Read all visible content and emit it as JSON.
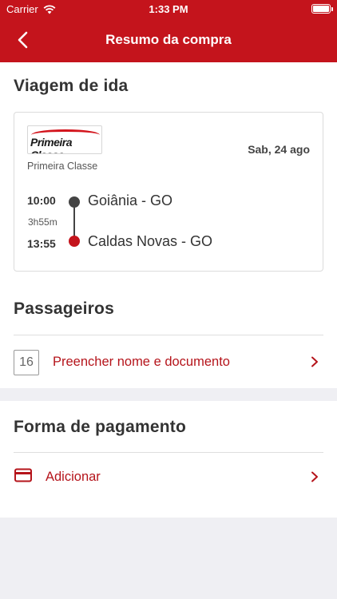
{
  "status_bar": {
    "carrier": "Carrier",
    "time": "1:33 PM"
  },
  "nav": {
    "title": "Resumo da compra"
  },
  "trip_section": {
    "heading": "Viagem de ida",
    "logo_text": "Primeira Classe",
    "company": "Primeira Classe",
    "date": "Sab, 24 ago",
    "departure_time": "10:00",
    "duration": "3h55m",
    "arrival_time": "13:55",
    "origin": "Goiânia - GO",
    "destination": "Caldas Novas - GO"
  },
  "passengers_section": {
    "heading": "Passageiros",
    "seat_number": "16",
    "fill_label": "Preencher nome e documento"
  },
  "payment_section": {
    "heading": "Forma de pagamento",
    "add_label": "Adicionar"
  },
  "colors": {
    "brand_red": "#c4141c",
    "link_red": "#b5141b",
    "background": "#efeff3"
  }
}
